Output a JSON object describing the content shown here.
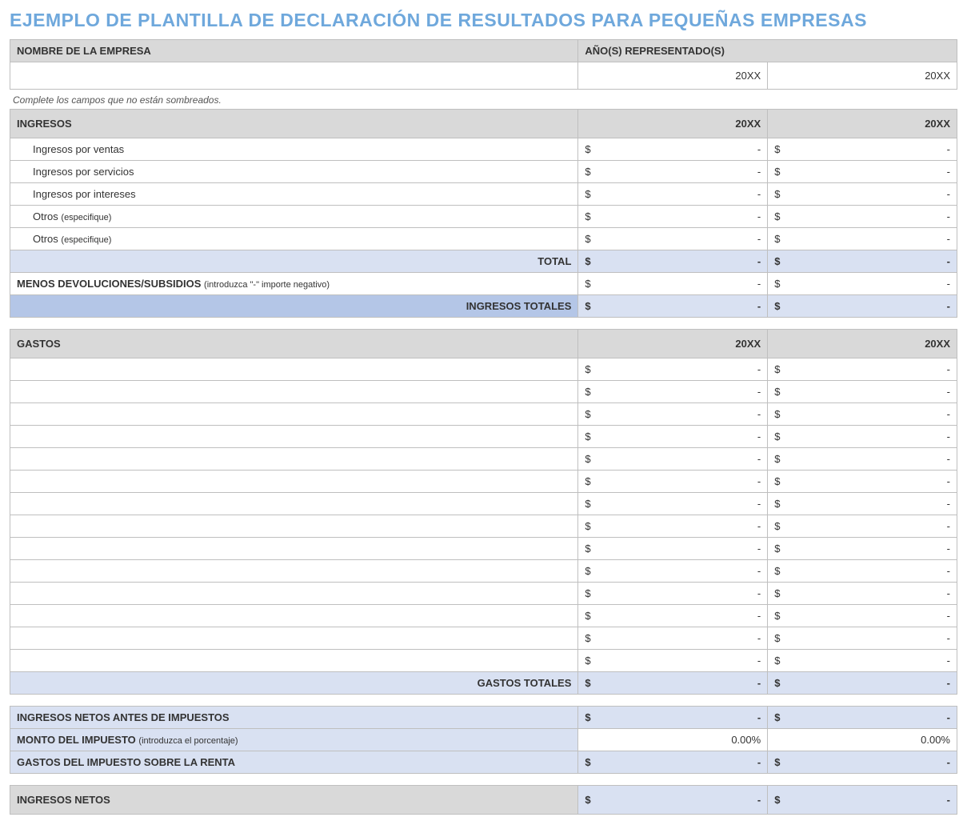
{
  "title": "EJEMPLO DE PLANTILLA DE DECLARACIÓN DE RESULTADOS PARA PEQUEÑAS EMPRESAS",
  "header": {
    "company_label": "NOMBRE DE LA EMPRESA",
    "years_label": "AÑO(S) REPRESENTADO(S)",
    "company_value": "",
    "year1": "20XX",
    "year2": "20XX"
  },
  "instruction": "Complete los campos que no están sombreados.",
  "currency": "$",
  "dash": "-",
  "ingresos": {
    "header": "INGRESOS",
    "year1": "20XX",
    "year2": "20XX",
    "rows": [
      {
        "label": "Ingresos por ventas",
        "v1": "-",
        "v2": "-"
      },
      {
        "label": "Ingresos por servicios",
        "v1": "-",
        "v2": "-"
      },
      {
        "label": "Ingresos por intereses",
        "v1": "-",
        "v2": "-"
      },
      {
        "label": "Otros",
        "note": "(especifique)",
        "v1": "-",
        "v2": "-"
      },
      {
        "label": "Otros",
        "note": "(especifique)",
        "v1": "-",
        "v2": "-"
      }
    ],
    "total_label": "TOTAL",
    "total_v1": "-",
    "total_v2": "-",
    "menos_label": "MENOS DEVOLUCIONES/SUBSIDIOS",
    "menos_note": "(introduzca \"-\" importe negativo)",
    "menos_v1": "-",
    "menos_v2": "-",
    "totales_label": "INGRESOS TOTALES",
    "totales_v1": "-",
    "totales_v2": "-"
  },
  "gastos": {
    "header": "GASTOS",
    "year1": "20XX",
    "year2": "20XX",
    "row_count": 14,
    "totales_label": "GASTOS TOTALES",
    "totales_v1": "-",
    "totales_v2": "-"
  },
  "summary": {
    "net_before_tax_label": "INGRESOS NETOS ANTES DE IMPUESTOS",
    "net_before_tax_v1": "-",
    "net_before_tax_v2": "-",
    "tax_amount_label": "MONTO DEL IMPUESTO",
    "tax_amount_note": "(introduzca el porcentaje)",
    "tax_amount_v1": "0.00%",
    "tax_amount_v2": "0.00%",
    "income_tax_expense_label": "GASTOS DEL IMPUESTO SOBRE LA RENTA",
    "income_tax_expense_v1": "-",
    "income_tax_expense_v2": "-",
    "net_income_label": "INGRESOS NETOS",
    "net_income_v1": "-",
    "net_income_v2": "-"
  }
}
